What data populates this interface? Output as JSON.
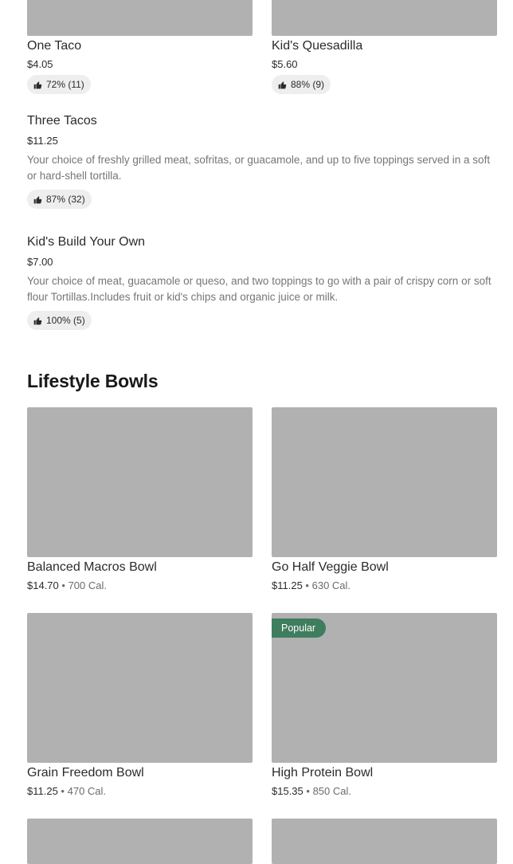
{
  "top_cards": [
    {
      "name": "One Taco",
      "price": "$4.05",
      "rating": "72% (11)"
    },
    {
      "name": "Kid's Quesadilla",
      "price": "$5.60",
      "rating": "88% (9)"
    }
  ],
  "list_items": [
    {
      "name": "Three Tacos",
      "price": "$11.25",
      "description": "Your choice of freshly grilled meat, sofritas, or guacamole, and up to five toppings served in a soft or hard-shell tortilla.",
      "rating": "87% (32)"
    },
    {
      "name": "Kid's Build Your Own",
      "price": "$7.00",
      "description": "Your choice of meat, guacamole or queso, and two toppings to go with a pair of crispy corn or soft flour Tortillas.Includes fruit or kid's chips and organic juice or milk.",
      "rating": "100% (5)"
    }
  ],
  "lifestyle": {
    "title": "Lifestyle Bowls",
    "separator": "•",
    "items": [
      {
        "name": "Balanced Macros Bowl",
        "price": "$14.70",
        "calories": "700 Cal."
      },
      {
        "name": "Go Half Veggie Bowl",
        "price": "$11.25",
        "calories": "630 Cal."
      },
      {
        "name": "Grain Freedom Bowl",
        "price": "$11.25",
        "calories": "470 Cal."
      },
      {
        "name": "High Protein Bowl",
        "price": "$15.35",
        "calories": "850 Cal.",
        "badge": "Popular"
      }
    ]
  },
  "icons": {
    "rating": "thumbs-up-icon"
  },
  "colors": {
    "image_placeholder": "#b1b1b1",
    "badge": "#3e7d5e",
    "rating_bg": "#eeeeee"
  }
}
